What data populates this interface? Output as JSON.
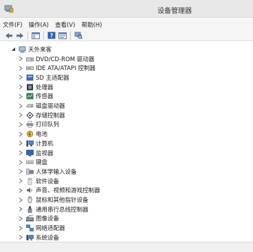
{
  "window": {
    "title": "设备管理器"
  },
  "menu": [
    "文件(F)",
    "操作(A)",
    "查看(V)",
    "帮助(H)"
  ],
  "toolbar": {
    "buttons": [
      "back-arrow-icon",
      "forward-arrow-icon",
      "console-tree-icon",
      "help-icon",
      "properties-icon",
      "scan-hardware-icon"
    ]
  },
  "tree": {
    "root": "天外来客",
    "items": [
      "DVD/CD-ROM 驱动器",
      "IDE ATA/ATAPI 控制器",
      "SD 主适配器",
      "处理器",
      "传感器",
      "磁盘驱动器",
      "存储控制器",
      "打印队列",
      "电池",
      "计算机",
      "监视器",
      "键盘",
      "人体学输入设备",
      "软件设备",
      "声音、视频和游戏控制器",
      "鼠标和其他指针设备",
      "通用串行总线控制器",
      "图像设备",
      "网络适配器",
      "系统设备"
    ]
  }
}
